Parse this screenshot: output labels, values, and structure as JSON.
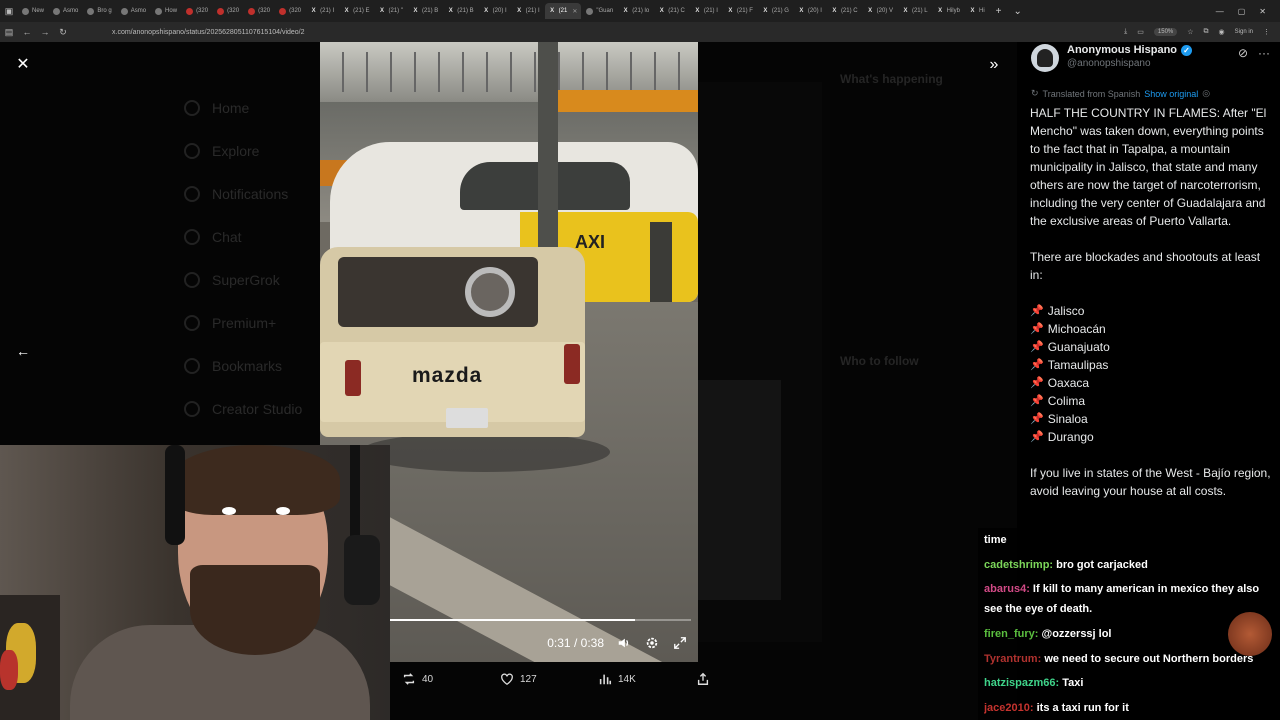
{
  "browser": {
    "tabs": [
      {
        "label": "New",
        "icon": "app-icon",
        "active": false
      },
      {
        "label": "Asmo",
        "icon": "app-icon",
        "active": false
      },
      {
        "label": "Bro g",
        "icon": "app-icon",
        "active": false
      },
      {
        "label": "Asmo",
        "icon": "app-icon",
        "active": false
      },
      {
        "label": "How",
        "icon": "app-icon",
        "active": false
      },
      {
        "label": "(320",
        "icon": "youtube-icon",
        "active": false
      },
      {
        "label": "(320",
        "icon": "youtube-icon",
        "active": false
      },
      {
        "label": "(320",
        "icon": "youtube-icon",
        "active": false
      },
      {
        "label": "(320",
        "icon": "youtube-icon",
        "active": false
      },
      {
        "label": "(21) I",
        "icon": "x-icon",
        "active": false
      },
      {
        "label": "(21) E",
        "icon": "x-icon",
        "active": false
      },
      {
        "label": "(21) \"",
        "icon": "x-icon",
        "active": false
      },
      {
        "label": "(21) B",
        "icon": "x-icon",
        "active": false
      },
      {
        "label": "(21) B",
        "icon": "x-icon",
        "active": false
      },
      {
        "label": "(20) I",
        "icon": "x-icon",
        "active": false
      },
      {
        "label": "(21) I",
        "icon": "x-icon",
        "active": false
      },
      {
        "label": "(21",
        "icon": "x-icon",
        "active": true
      },
      {
        "label": "\"Guan",
        "icon": "app-icon",
        "active": false
      },
      {
        "label": "(21) lo",
        "icon": "x-icon",
        "active": false
      },
      {
        "label": "(21) C",
        "icon": "x-icon",
        "active": false
      },
      {
        "label": "(21) I",
        "icon": "x-icon",
        "active": false
      },
      {
        "label": "(21) F",
        "icon": "x-icon",
        "active": false
      },
      {
        "label": "(21) G",
        "icon": "x-icon",
        "active": false
      },
      {
        "label": "(20) I",
        "icon": "x-icon",
        "active": false
      },
      {
        "label": "(21) C",
        "icon": "x-icon",
        "active": false
      },
      {
        "label": "(20) V",
        "icon": "x-icon",
        "active": false
      },
      {
        "label": "(21) L",
        "icon": "x-icon",
        "active": false
      },
      {
        "label": "Hilyb",
        "icon": "x-icon",
        "active": false
      },
      {
        "label": "Hi",
        "icon": "x-icon",
        "active": false
      }
    ],
    "url": "x.com/anonopshispano/status/2025628051107615104/video/2",
    "zoom": "150%",
    "sign_in": "Sign in"
  },
  "background": {
    "nav": [
      "Home",
      "Explore",
      "Notifications",
      "Chat",
      "SuperGrok",
      "Premium+",
      "Bookmarks",
      "Creator Studio"
    ],
    "whats_happening": "What's happening",
    "who_to_follow": "Who to follow"
  },
  "video": {
    "time_current": "0:31",
    "time_total": "0:38",
    "time_separator": "/",
    "progress_fraction": 0.816,
    "brand_text": "mazda",
    "taxi_text": "AXI"
  },
  "actions": {
    "reposts": "40",
    "likes": "127",
    "views": "14K"
  },
  "tweet": {
    "author_name": "Anonymous Hispano",
    "author_handle": "@anonopshispano",
    "translated_label": "Translated from Spanish",
    "show_original": "Show original",
    "para1": "HALF THE COUNTRY IN FLAMES: After \"El Mencho\" was taken down, everything points to the fact that in Tapalpa, a mountain municipality in Jalisco, that state and many others are now the target of narcoterrorism, including the very center of Guadalajara and the exclusive areas of Puerto Vallarta.",
    "para2": "There are blockades and shootouts at least in:",
    "states": [
      "Jalisco",
      "Michoacán",
      "Guanajuato",
      "Tamaulipas",
      "Oaxaca",
      "Colima",
      "Sinaloa",
      "Durango"
    ],
    "para3": "If you live in states of the West - Bajío region, avoid leaving your house at all costs."
  },
  "chat": {
    "messages": [
      {
        "user": "",
        "text": "time",
        "color": "#ffffff"
      },
      {
        "user": "cadetshrimp:",
        "text": "bro got carjacked",
        "color": "#7cd65a"
      },
      {
        "user": "abarus4:",
        "text": "If kill to many american in mexico they also see the eye of death.",
        "color": "#d24a86",
        "wrap": true
      },
      {
        "user": "firen_fury:",
        "text": "@ozzerssj lol",
        "color": "#5bbf3f"
      },
      {
        "user": "Tyrantrum:",
        "text": "we need to secure out Northern borders",
        "color": "#b0322f"
      },
      {
        "user": "hatzispazm66:",
        "text": "Taxi",
        "color": "#3fd48a"
      },
      {
        "user": "jace2010:",
        "text": "its a taxi run for it",
        "color": "#c5332e"
      }
    ]
  },
  "colors": {
    "accent": "#1d9bf0",
    "page_bg": "#000000",
    "text": "#e7e9ea",
    "muted": "#71767b"
  }
}
